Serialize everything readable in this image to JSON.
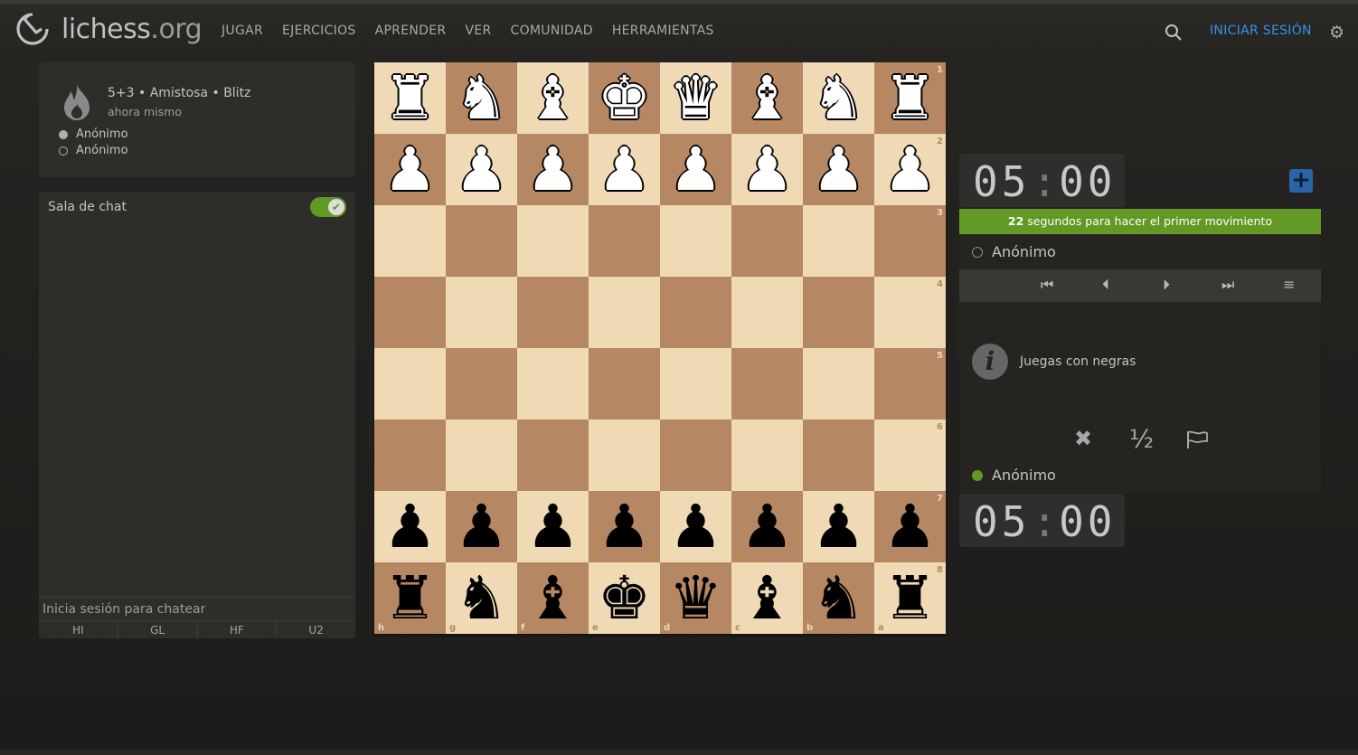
{
  "site": {
    "name": "lichess",
    "domain": ".org"
  },
  "nav": [
    "JUGAR",
    "EJERCICIOS",
    "APRENDER",
    "VER",
    "COMUNIDAD",
    "HERRAMIENTAS"
  ],
  "header": {
    "signin_label": "INICIAR SESIÓN",
    "search_icon": "search-icon",
    "settings_icon": "gear-icon"
  },
  "game_info": {
    "title": "5+3 • Amistosa • Blitz",
    "time": "ahora mismo",
    "players": [
      "Anónimo",
      "Anónimo"
    ]
  },
  "chat": {
    "title": "Sala de chat",
    "enabled": true,
    "login_prompt": "Inicia sesión para chatear",
    "presets": [
      "HI",
      "GL",
      "HF",
      "U2"
    ]
  },
  "board": {
    "orientation": "black",
    "ranks": [
      "1",
      "2",
      "3",
      "4",
      "5",
      "6",
      "7",
      "8"
    ],
    "files": [
      "h",
      "g",
      "f",
      "e",
      "d",
      "c",
      "b",
      "a"
    ],
    "rows": [
      [
        "wR",
        "wN",
        "wB",
        "wK",
        "wQ",
        "wB",
        "wN",
        "wR"
      ],
      [
        "wP",
        "wP",
        "wP",
        "wP",
        "wP",
        "wP",
        "wP",
        "wP"
      ],
      [
        "",
        "",
        "",
        "",
        "",
        "",
        "",
        ""
      ],
      [
        "",
        "",
        "",
        "",
        "",
        "",
        "",
        ""
      ],
      [
        "",
        "",
        "",
        "",
        "",
        "",
        "",
        ""
      ],
      [
        "",
        "",
        "",
        "",
        "",
        "",
        "",
        ""
      ],
      [
        "bP",
        "bP",
        "bP",
        "bP",
        "bP",
        "bP",
        "bP",
        "bP"
      ],
      [
        "bR",
        "bN",
        "bB",
        "bK",
        "bQ",
        "bB",
        "bN",
        "bR"
      ]
    ],
    "colors": {
      "light": "#f0d9b5",
      "dark": "#b58863"
    }
  },
  "clocks": {
    "top": {
      "min": "05",
      "sep": ":",
      "sec": "00"
    },
    "bottom": {
      "min": "05",
      "sep": ":",
      "sec": "00"
    }
  },
  "table": {
    "banner_seconds": "22",
    "banner_text": " segundos para hacer el primer movimiento",
    "top_player": "Anónimo",
    "bottom_player": "Anónimo",
    "info_text": "Juegas con negras",
    "controls": [
      "first-icon",
      "prev-icon",
      "next-icon",
      "last-icon",
      "menu-icon"
    ],
    "actions": {
      "abort": "✖",
      "draw": "½",
      "resign": "flag-icon"
    }
  },
  "accent": {
    "green": "#629924",
    "blue": "#3692e7"
  }
}
